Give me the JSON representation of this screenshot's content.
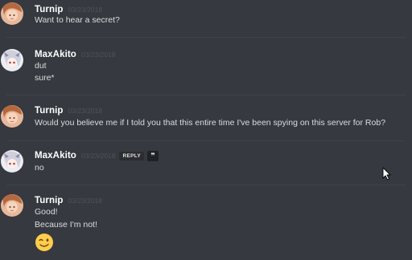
{
  "colors": {
    "background": "#36393f",
    "author": "#ffffff",
    "timestamp": "#50535a",
    "text": "#dcddde"
  },
  "messages": [
    {
      "author": "Turnip",
      "avatar": "turnip-avatar",
      "timestamp": "03/23/2018",
      "lines": [
        "Want to hear a secret?"
      ]
    },
    {
      "author": "MaxAkito",
      "avatar": "maxakito-avatar",
      "timestamp": "03/23/2018",
      "lines": [
        "dut",
        "sure*"
      ]
    },
    {
      "author": "Turnip",
      "avatar": "turnip-avatar",
      "timestamp": "03/23/2018",
      "lines": [
        "Would you believe me if I told you that this entire time I've been spying on this server for Rob?"
      ]
    },
    {
      "author": "MaxAkito",
      "avatar": "maxakito-avatar",
      "timestamp": "03/23/2018",
      "reply_label": "REPLY",
      "quote_label": "❞",
      "lines": [
        "no"
      ]
    },
    {
      "author": "Turnip",
      "avatar": "turnip-avatar",
      "timestamp": "03/23/2018",
      "lines": [
        "Good!",
        "Because I'm not!"
      ],
      "emoji": "winking-face-emoji"
    }
  ]
}
